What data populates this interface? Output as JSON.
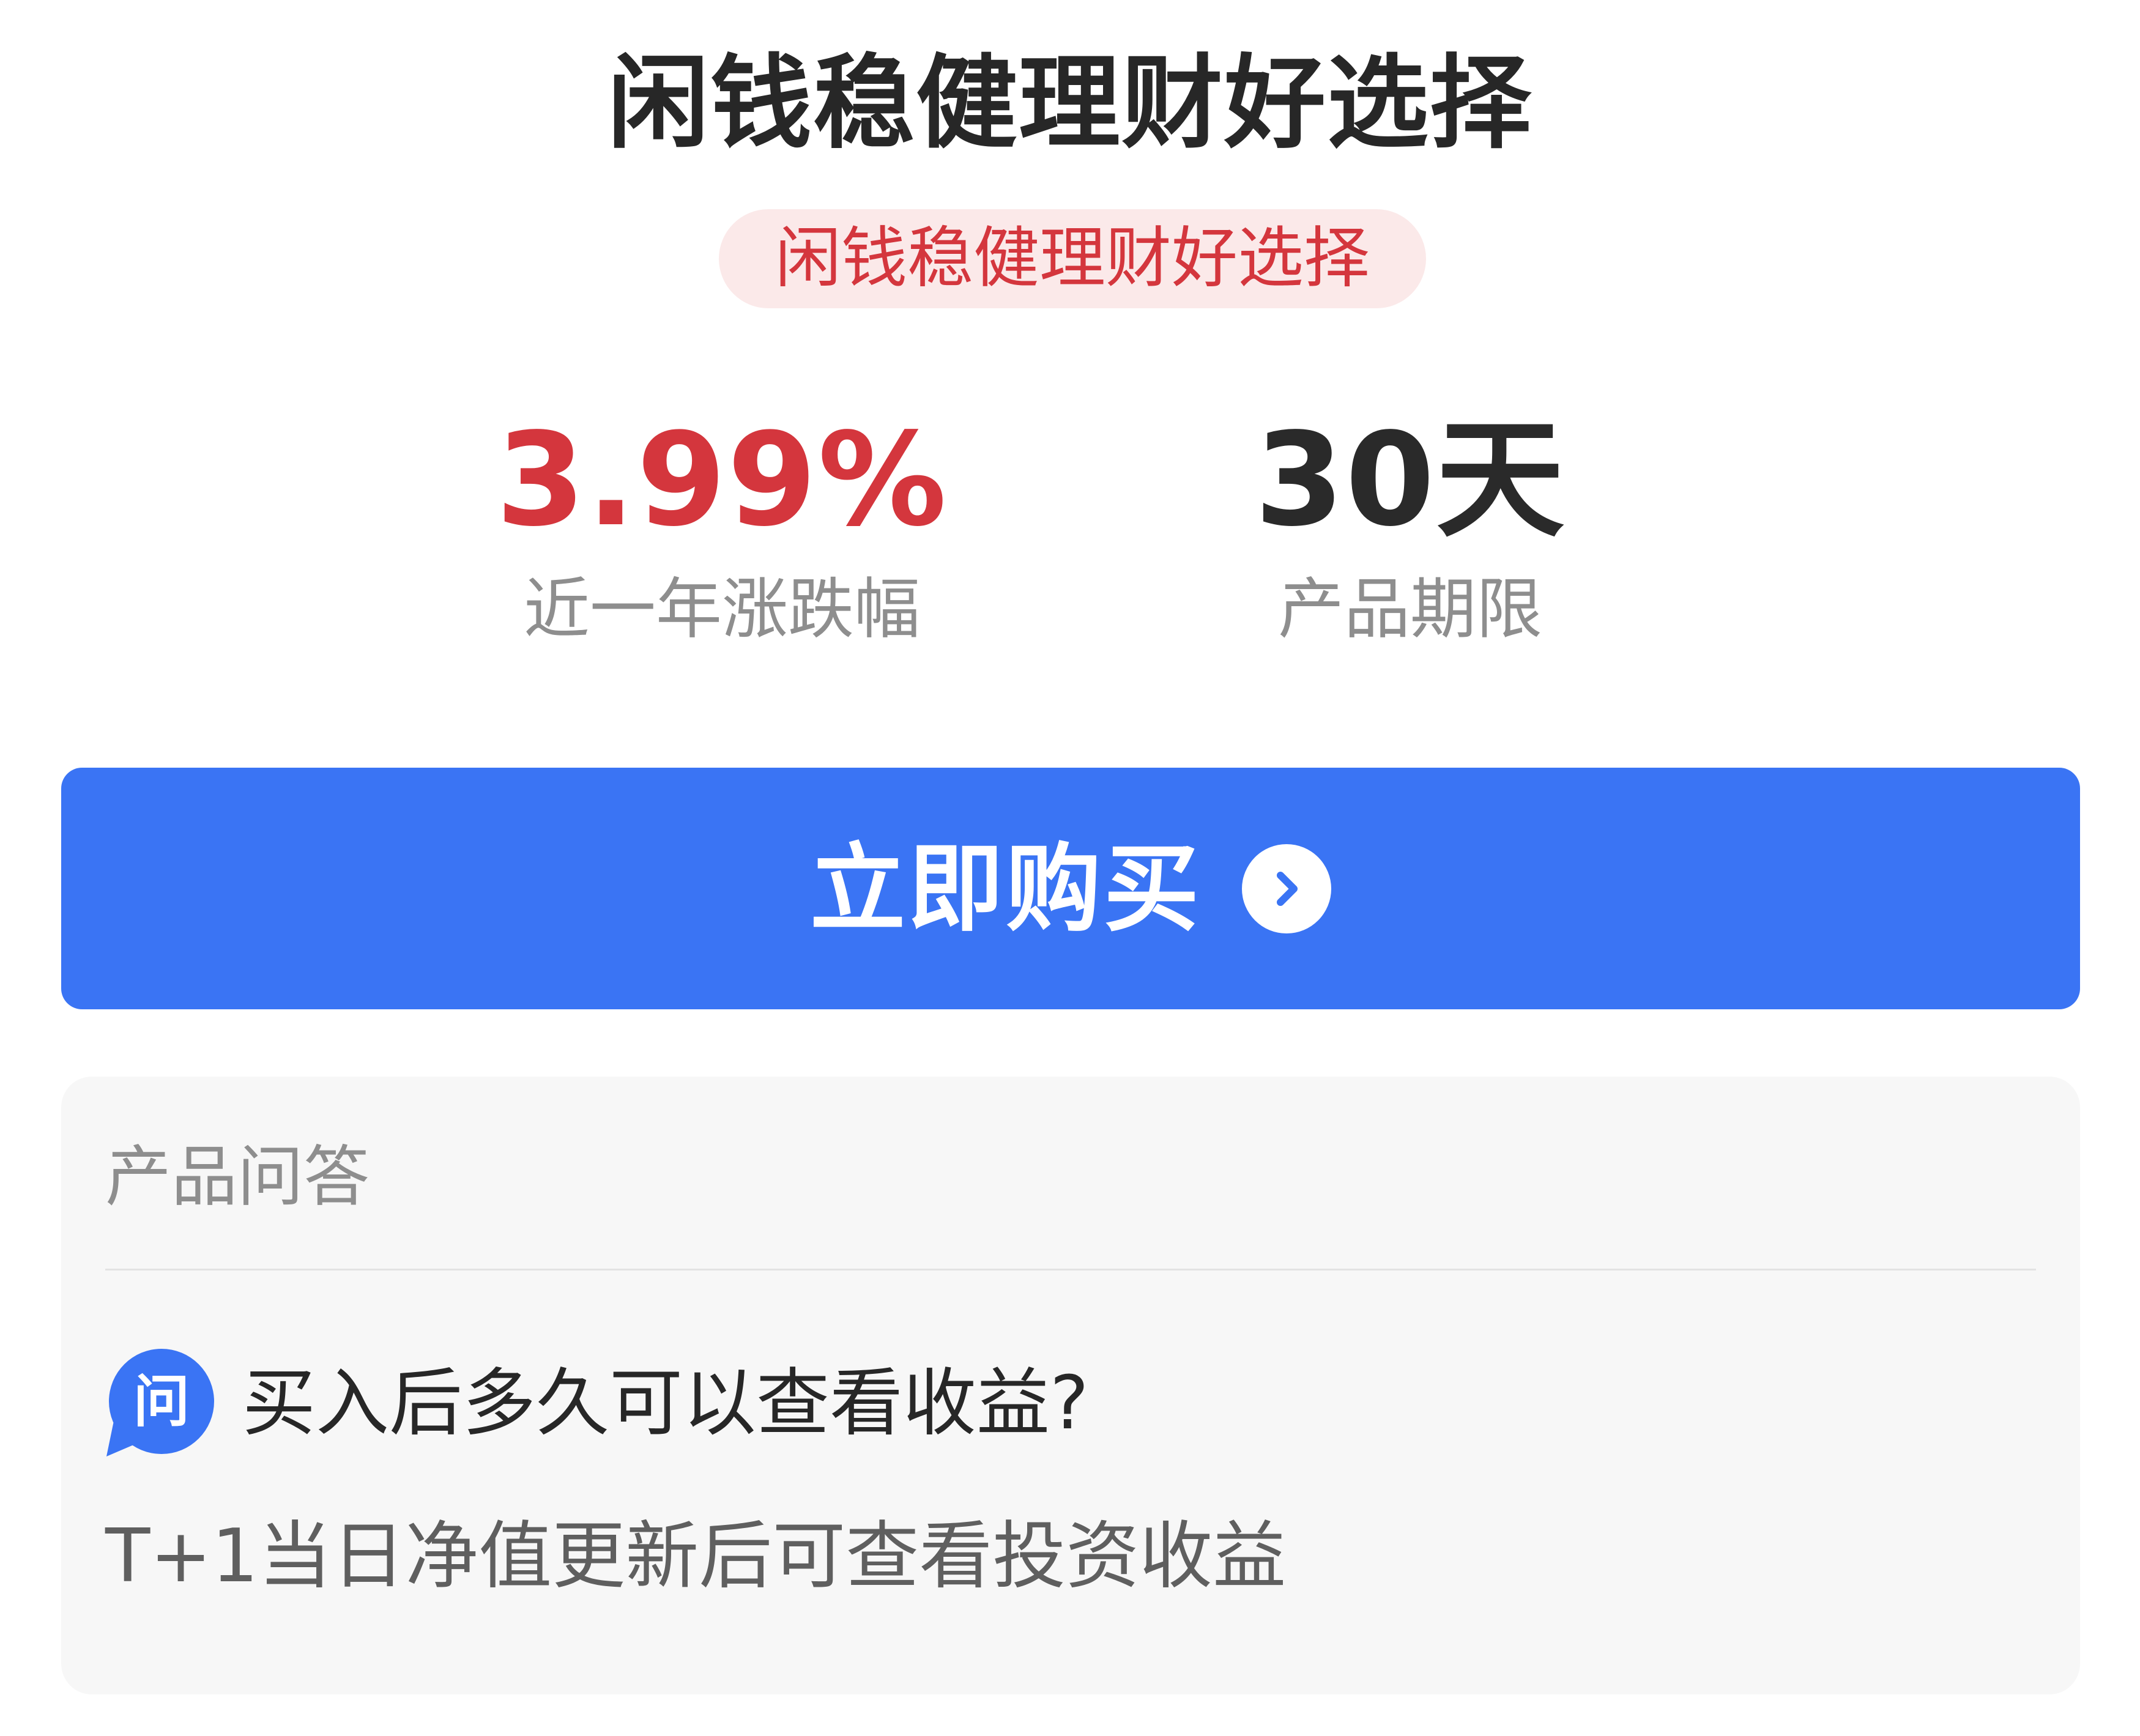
{
  "header": {
    "title": "闲钱稳健理财好选择",
    "tag": "闲钱稳健理财好选择"
  },
  "stats": {
    "rate": {
      "value": "3.99%",
      "label": "近一年涨跌幅"
    },
    "term": {
      "value": "30天",
      "label": "产品期限"
    }
  },
  "buy_button": {
    "label": "立即购买",
    "icon": "chevron-right-circle-icon"
  },
  "qa": {
    "header": "产品问答",
    "question_icon_text": "问",
    "question": "买入后多久可以查看收益?",
    "answer": "T+1当日净值更新后可查看投资收益"
  },
  "colors": {
    "accent_red": "#d4363d",
    "tag_background": "#fbe9e9",
    "button_blue": "#3a74f4",
    "card_background": "#f7f7f7"
  }
}
